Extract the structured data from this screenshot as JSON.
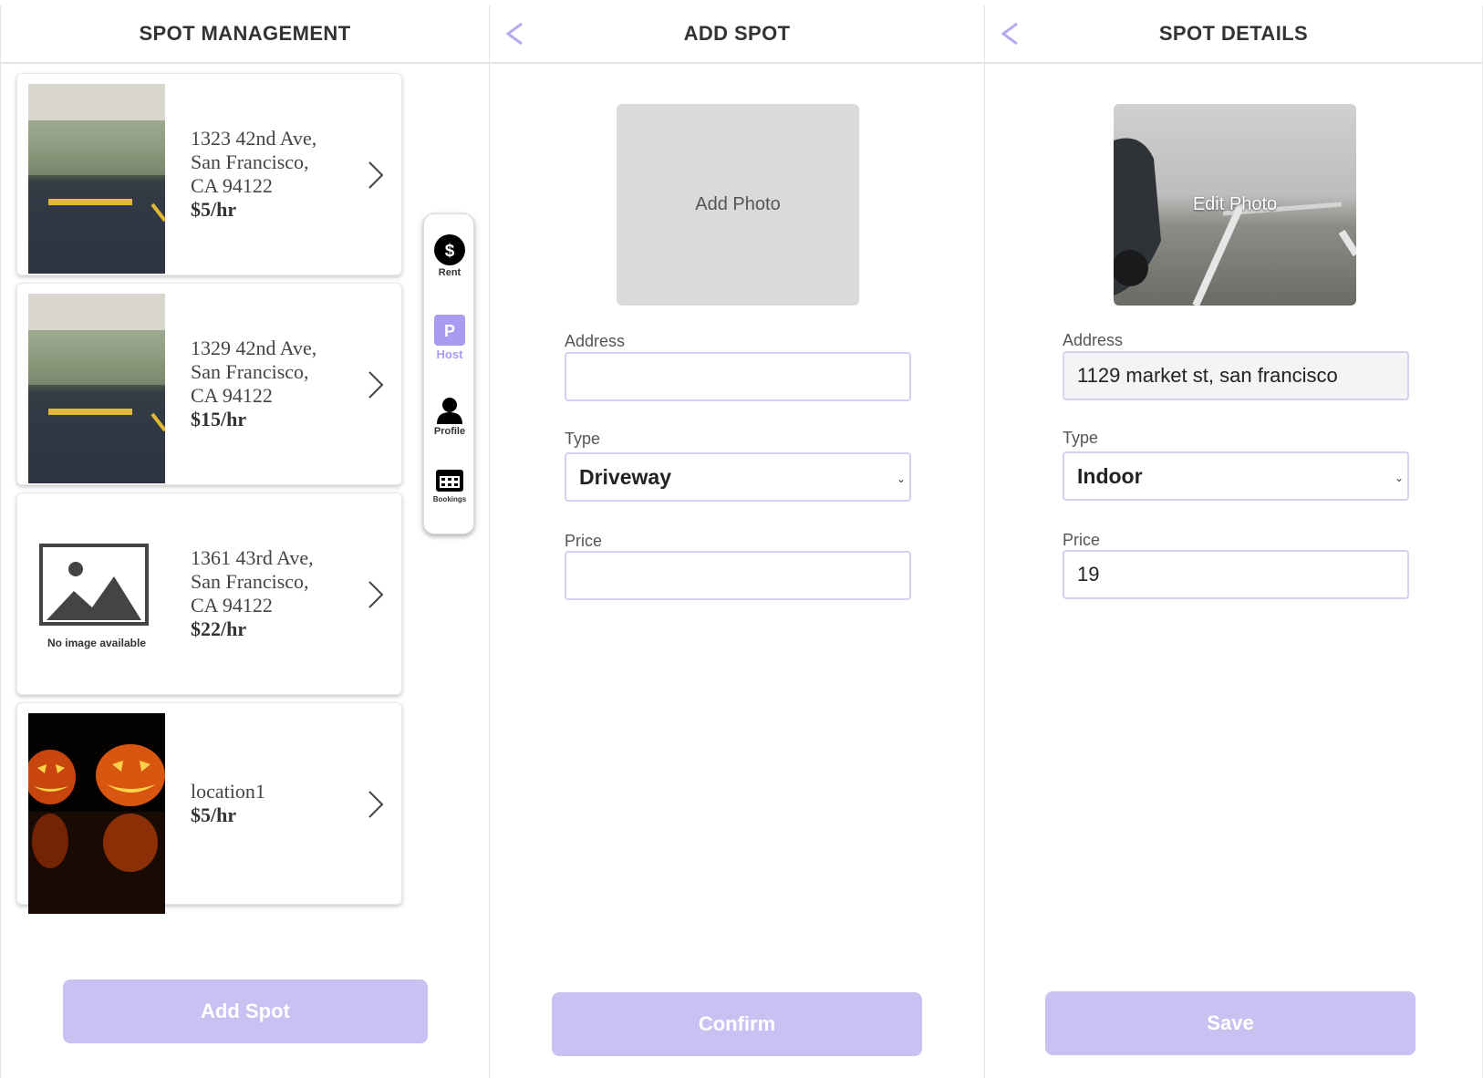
{
  "management": {
    "title": "SPOT MANAGEMENT",
    "spots": [
      {
        "line1": "1323 42nd Ave,",
        "line2": "San Francisco,",
        "line3": "CA 94122",
        "price": "$5/hr",
        "image": "parking-lot-photo"
      },
      {
        "line1": "1329 42nd Ave,",
        "line2": "San Francisco,",
        "line3": "CA 94122",
        "price": "$15/hr",
        "image": "parking-lot-photo"
      },
      {
        "line1": "1361 43rd Ave,",
        "line2": "San Francisco,",
        "line3": "CA 94122",
        "price": "$22/hr",
        "image": "no-image-placeholder",
        "placeholder_text": "No image available"
      },
      {
        "line1": "location1",
        "price": "$5/hr",
        "image": "pumpkins-photo"
      }
    ],
    "add_button": "Add Spot"
  },
  "nav": {
    "items": [
      {
        "label": "Rent",
        "icon": "dollar-icon",
        "active": false
      },
      {
        "label": "Host",
        "icon": "parking-icon",
        "active": true
      },
      {
        "label": "Profile",
        "icon": "person-icon",
        "active": false
      },
      {
        "label": "Bookings",
        "icon": "calendar-icon",
        "active": false
      }
    ]
  },
  "add_spot": {
    "title": "ADD SPOT",
    "photo_label": "Add Photo",
    "address_label": "Address",
    "address_value": "",
    "type_label": "Type",
    "type_value": "Driveway",
    "price_label": "Price",
    "price_value": "",
    "confirm_button": "Confirm"
  },
  "spot_details": {
    "title": "SPOT DETAILS",
    "photo_label": "Edit Photo",
    "address_label": "Address",
    "address_value": "1129 market st, san francisco",
    "type_label": "Type",
    "type_value": "Indoor",
    "price_label": "Price",
    "price_value": "19",
    "save_button": "Save"
  },
  "colors": {
    "accent": "#a89cf0",
    "button": "#c8c2f2",
    "field_border": "#d6d0f2"
  }
}
